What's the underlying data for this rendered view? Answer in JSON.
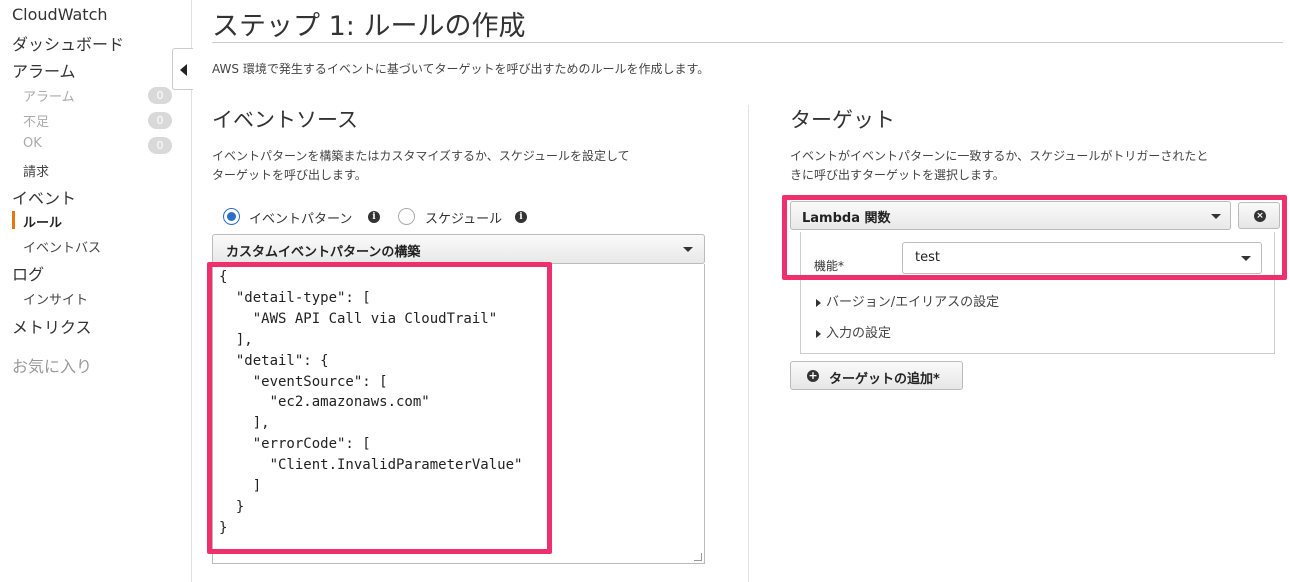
{
  "sidebar": {
    "items": [
      {
        "label": "CloudWatch"
      },
      {
        "label": "ダッシュボード"
      },
      {
        "label": "アラーム"
      },
      {
        "label": "アラーム",
        "count": "0"
      },
      {
        "label": "不足",
        "count": "0"
      },
      {
        "label": "OK",
        "count": "0"
      },
      {
        "label": "請求"
      },
      {
        "label": "イベント"
      },
      {
        "label": "ルール"
      },
      {
        "label": "イベントバス"
      },
      {
        "label": "ログ"
      },
      {
        "label": "インサイト"
      },
      {
        "label": "メトリクス"
      }
    ],
    "favorites": "お気に入り",
    "active_color": "#e47911"
  },
  "page": {
    "title": "ステップ 1: ルールの作成",
    "description": "AWS 環境で発生するイベントに基づいてターゲットを呼び出すためのルールを作成します。"
  },
  "event_source": {
    "title": "イベントソース",
    "description_line1": "イベントパターンを構築またはカスタマイズするか、スケジュールを設定して",
    "description_line2": "ターゲットを呼び出します。",
    "radio_event_pattern": "イベントパターン",
    "radio_schedule": "スケジュール",
    "pattern_select": "カスタムイベントパターンの構築",
    "pattern_json": "{\n  \"detail-type\": [\n    \"AWS API Call via CloudTrail\"\n  ],\n  \"detail\": {\n    \"eventSource\": [\n      \"ec2.amazonaws.com\"\n    ],\n    \"errorCode\": [\n      \"Client.InvalidParameterValue\"\n    ]\n  }\n}"
  },
  "targets": {
    "title": "ターゲット",
    "description_line1": "イベントがイベントパターンに一致するか、スケジュールがトリガーされたと",
    "description_line2": "きに呼び出すターゲットを選択します。",
    "target_type": "Lambda 関数",
    "function_label": "機能*",
    "function_value": "test",
    "version_alias": "バージョン/エイリアスの設定",
    "input_settings": "入力の設定",
    "add_target": "ターゲットの追加*"
  },
  "colors": {
    "highlight": "#f0306c",
    "radio_selected": "#2c6fc5"
  }
}
